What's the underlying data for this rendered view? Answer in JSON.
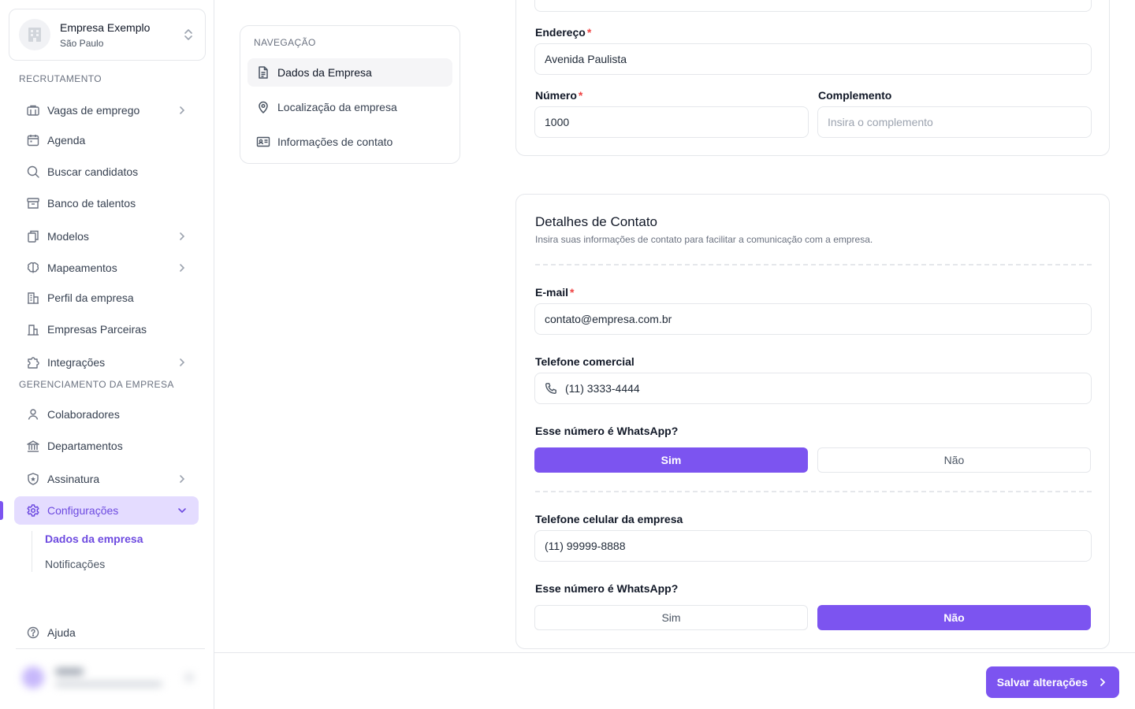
{
  "company": {
    "name": "Empresa Exemplo",
    "city": "São Paulo"
  },
  "sidebar": {
    "sections": {
      "recruitment": "RECRUTAMENTO",
      "management": "GERENCIAMENTO DA EMPRESA"
    },
    "items": [
      {
        "label": "Vagas de emprego",
        "icon": "briefcase-icon"
      },
      {
        "label": "Agenda",
        "icon": "calendar-icon"
      },
      {
        "label": "Buscar candidatos",
        "icon": "search-icon"
      },
      {
        "label": "Banco de talentos",
        "icon": "archive-icon"
      },
      {
        "label": "Modelos",
        "icon": "copy-icon"
      },
      {
        "label": "Mapeamentos",
        "icon": "brain-icon"
      },
      {
        "label": "Perfil da empresa",
        "icon": "building-icon"
      },
      {
        "label": "Empresas Parceiras",
        "icon": "buildings-icon"
      },
      {
        "label": "Integrações",
        "icon": "puzzle-icon"
      },
      {
        "label": "Colaboradores",
        "icon": "user-icon"
      },
      {
        "label": "Departamentos",
        "icon": "bank-icon"
      },
      {
        "label": "Assinatura",
        "icon": "shield-star-icon"
      },
      {
        "label": "Configurações",
        "icon": "gear-icon"
      }
    ],
    "sub_items": [
      "Dados da empresa",
      "Notificações"
    ],
    "help": "Ajuda"
  },
  "page_nav": {
    "title": "NAVEGAÇÃO",
    "items": [
      "Dados da Empresa",
      "Localização da empresa",
      "Informações de contato"
    ]
  },
  "address": {
    "street_label": "Endereço",
    "street_value": "Avenida Paulista",
    "number_label": "Número",
    "number_value": "1000",
    "complement_label": "Complemento",
    "complement_placeholder": "Insira o complemento"
  },
  "contact": {
    "title": "Detalhes de Contato",
    "subtitle": "Insira suas informações de contato para facilitar a comunicação com a empresa.",
    "email_label": "E-mail",
    "email_value": "contato@empresa.com.br",
    "phone_label": "Telefone comercial",
    "phone_value": "(11) 3333-4444",
    "whatsapp_question": "Esse número é WhatsApp?",
    "yes": "Sim",
    "no": "Não",
    "mobile_label": "Telefone celular da empresa",
    "mobile_value": "(11) 99999-8888",
    "phone_whatsapp": "Sim",
    "mobile_whatsapp": "Não"
  },
  "footer": {
    "save_label": "Salvar alterações"
  },
  "colors": {
    "accent": "#7c54f0",
    "accent_soft": "#e4dcff",
    "required": "#ef4444"
  }
}
